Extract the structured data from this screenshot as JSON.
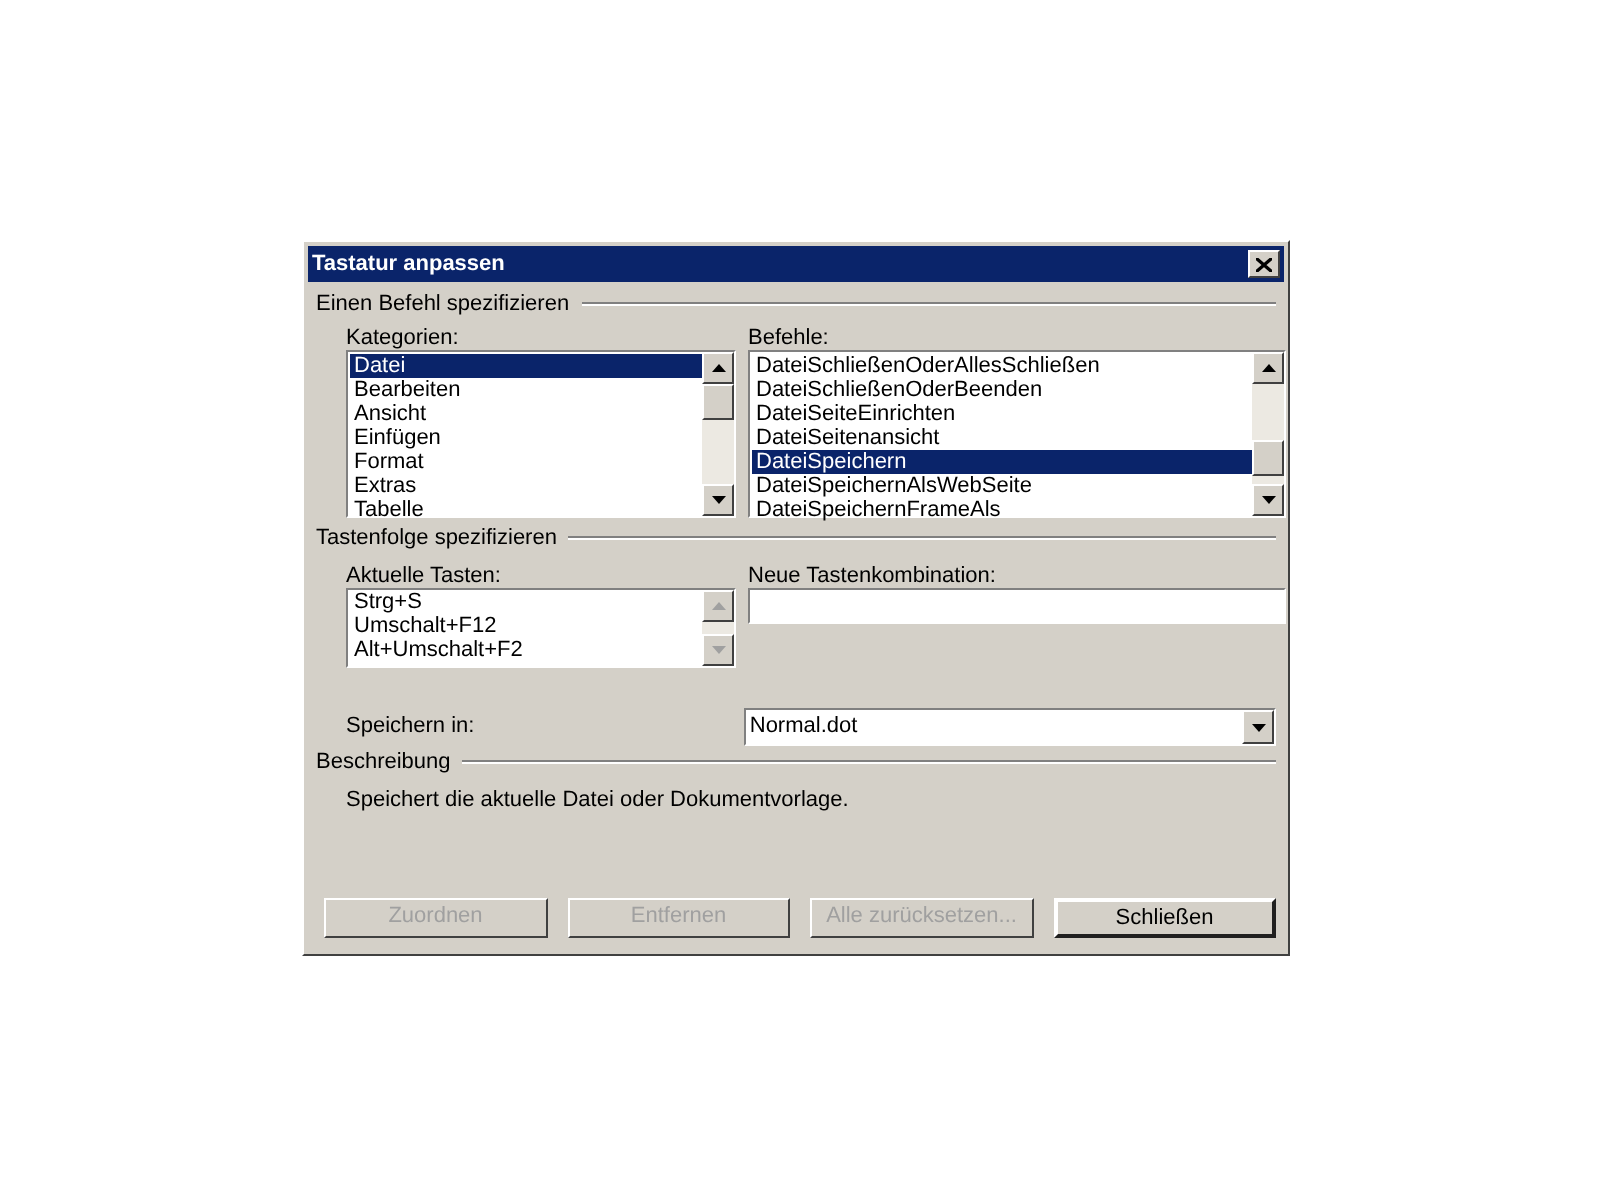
{
  "window": {
    "title": "Tastatur anpassen"
  },
  "command_section": {
    "heading": "Einen Befehl spezifizieren",
    "categories": {
      "label": "Kategorien:",
      "items": [
        {
          "label": "Datei",
          "selected": true
        },
        {
          "label": "Bearbeiten",
          "selected": false
        },
        {
          "label": "Ansicht",
          "selected": false
        },
        {
          "label": "Einfügen",
          "selected": false
        },
        {
          "label": "Format",
          "selected": false
        },
        {
          "label": "Extras",
          "selected": false
        },
        {
          "label": "Tabelle",
          "selected": false
        }
      ]
    },
    "commands": {
      "label": "Befehle:",
      "items": [
        {
          "label": "DateiSchließenOderAllesSchließen",
          "selected": false
        },
        {
          "label": "DateiSchließenOderBeenden",
          "selected": false
        },
        {
          "label": "DateiSeiteEinrichten",
          "selected": false
        },
        {
          "label": "DateiSeitenansicht",
          "selected": false
        },
        {
          "label": "DateiSpeichern",
          "selected": true
        },
        {
          "label": "DateiSpeichernAlsWebSeite",
          "selected": false
        },
        {
          "label": "DateiSpeichernFrameAls",
          "selected": false
        }
      ]
    }
  },
  "key_section": {
    "heading": "Tastenfolge spezifizieren",
    "current_keys": {
      "label": "Aktuelle Tasten:",
      "items": [
        "Strg+S",
        "Umschalt+F12",
        "Alt+Umschalt+F2"
      ]
    },
    "new_key": {
      "label": "Neue Tastenkombination:"
    },
    "save_in": {
      "label": "Speichern in:",
      "value": "Normal.dot"
    }
  },
  "description": {
    "heading": "Beschreibung",
    "text": "Speichert die aktuelle Datei oder Dokumentvorlage."
  },
  "buttons": [
    {
      "label": "Zuordnen",
      "disabled": true
    },
    {
      "label": "Entfernen",
      "disabled": true
    },
    {
      "label": "Alle zurücksetzen...",
      "disabled": true
    },
    {
      "label": "Schließen",
      "disabled": false
    }
  ]
}
